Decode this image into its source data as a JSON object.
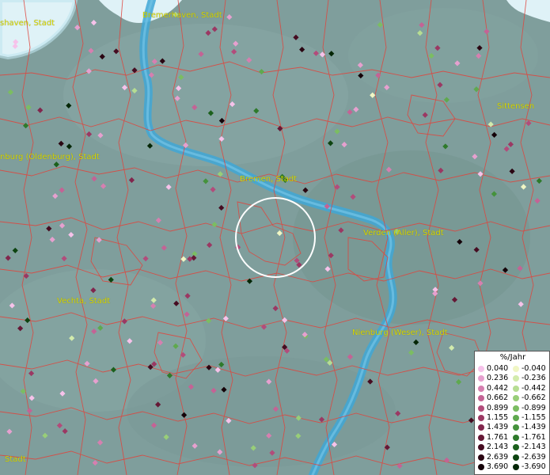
{
  "map": {
    "places": [
      {
        "name": "shaven, Stadt"
      },
      {
        "name": "Bremerhaven, Stadt"
      },
      {
        "name": "nburg (Oldenburg), Stadt"
      },
      {
        "name": "Bremen, Stadt"
      },
      {
        "name": "Verden (Aller), Stadt"
      },
      {
        "name": "Vechta, Stadt"
      },
      {
        "name": "Nienburg (Weser), Stadt"
      },
      {
        "name": "Sittensen"
      },
      {
        "name": "Stadt"
      }
    ],
    "colors": {
      "land": "#7f9e9c",
      "water_highlight": "#e8f6fa",
      "river": "#3fa7d6",
      "boundaries": "#e0443c",
      "label": "#d8d800",
      "circle": "#ffffff"
    }
  },
  "legend": {
    "title": "%/Jahr",
    "positive": [
      {
        "value": "0.040",
        "color": "#f6c2ea"
      },
      {
        "value": "0.236",
        "color": "#e6a0cf"
      },
      {
        "value": "0.442",
        "color": "#d67fb0"
      },
      {
        "value": "0.662",
        "color": "#c46395"
      },
      {
        "value": "0.899",
        "color": "#b24c7b"
      },
      {
        "value": "1.155",
        "color": "#9b3863"
      },
      {
        "value": "1.439",
        "color": "#81264d"
      },
      {
        "value": "1.761",
        "color": "#651836"
      },
      {
        "value": "2.143",
        "color": "#460c21"
      },
      {
        "value": "2.639",
        "color": "#2a0612"
      },
      {
        "value": "3.690",
        "color": "#140208"
      }
    ],
    "negative": [
      {
        "value": "-0.040",
        "color": "#f0f6c4"
      },
      {
        "value": "-0.236",
        "color": "#d2ebac"
      },
      {
        "value": "-0.442",
        "color": "#b6dd92"
      },
      {
        "value": "-0.662",
        "color": "#98ce78"
      },
      {
        "value": "-0.899",
        "color": "#7bbd62"
      },
      {
        "value": "-1.155",
        "color": "#5fa94e"
      },
      {
        "value": "-1.439",
        "color": "#45923c"
      },
      {
        "value": "-1.761",
        "color": "#2e7a2b"
      },
      {
        "value": "-2.143",
        "color": "#1b601c"
      },
      {
        "value": "-2.639",
        "color": "#0d4410"
      },
      {
        "value": "-3.690",
        "color": "#042606"
      }
    ]
  }
}
